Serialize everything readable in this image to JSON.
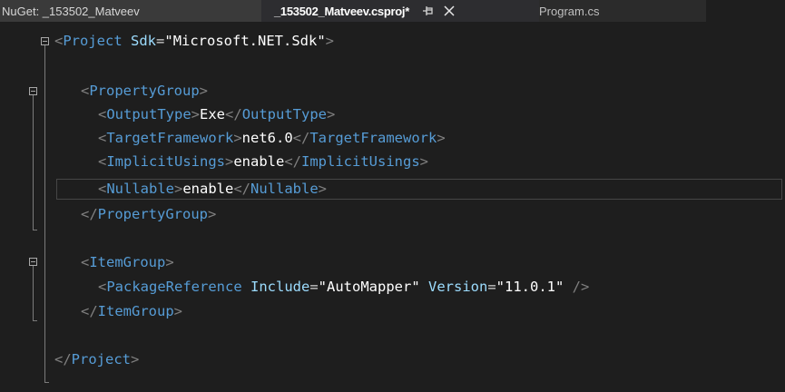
{
  "tabs": {
    "nuget": "NuGet: _153502_Matveev",
    "csproj": "_153502_Matveev.csproj*",
    "program": "Program.cs"
  },
  "code": {
    "project_open_tag": "Project",
    "sdk_attr": "Sdk",
    "sdk_value": "\"Microsoft.NET.Sdk\"",
    "property_group": "PropertyGroup",
    "output_type_tag": "OutputType",
    "output_type_value": "Exe",
    "target_framework_tag": "TargetFramework",
    "target_framework_value": "net6.0",
    "implicit_usings_tag": "ImplicitUsings",
    "implicit_usings_value": "enable",
    "nullable_tag": "Nullable",
    "nullable_value": "enable",
    "item_group": "ItemGroup",
    "package_reference_tag": "PackageReference",
    "include_attr": "Include",
    "include_value": "\"AutoMapper\"",
    "version_attr": "Version",
    "version_value": "\"11.0.1\"",
    "project_close_tag": "Project"
  },
  "colors": {
    "background": "#1e1e1e",
    "tag": "#569cd6",
    "attribute": "#9cdcfe",
    "bracket": "#808080",
    "text": "#ffffff"
  }
}
